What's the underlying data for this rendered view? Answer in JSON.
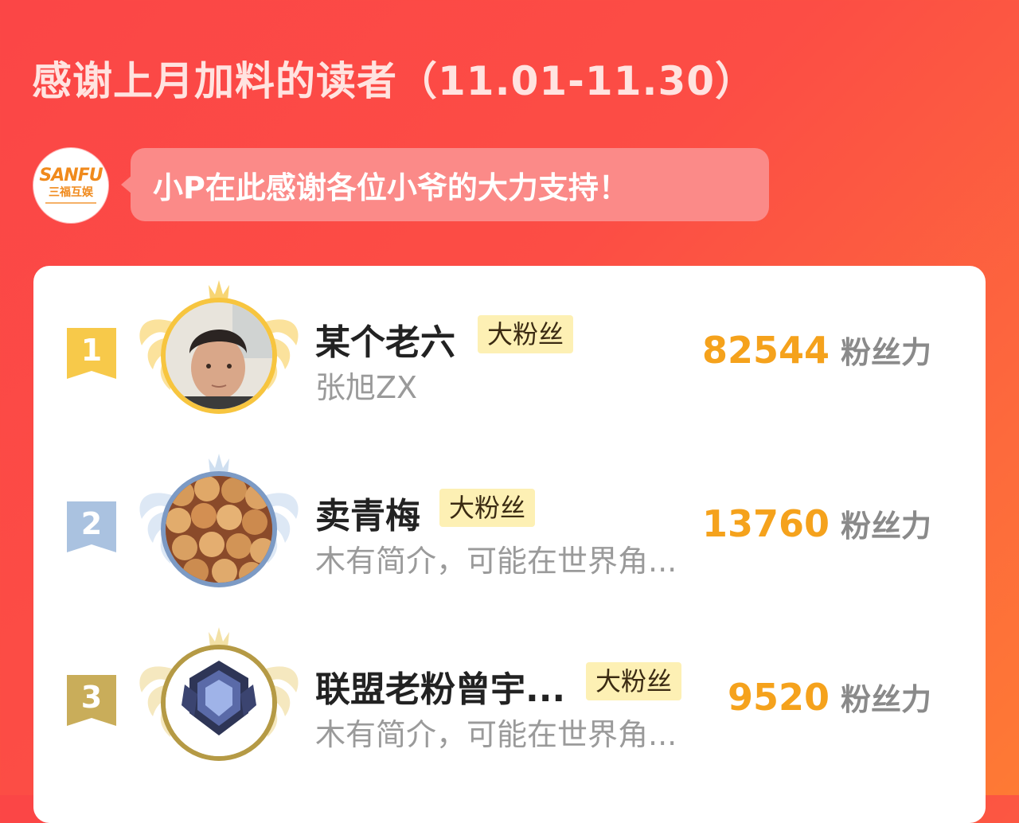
{
  "page_title": "感谢上月加料的读者（11.01-11.30）",
  "logo": {
    "brand": "SANFU",
    "name": "三福互娱"
  },
  "bubble_text": "小P在此感谢各位小爷的大力支持！",
  "ranking": [
    {
      "rank": "1",
      "name": "某个老六",
      "tag": "大粉丝",
      "desc": "张旭ZX",
      "score": "82544",
      "unit": "粉丝力"
    },
    {
      "rank": "2",
      "name": "卖青梅",
      "tag": "大粉丝",
      "desc": "木有简介，可能在世界角...",
      "score": "13760",
      "unit": "粉丝力"
    },
    {
      "rank": "3",
      "name": "联盟老粉曾宇...",
      "tag": "大粉丝",
      "desc": "木有简介，可能在世界角...",
      "score": "9520",
      "unit": "粉丝力"
    }
  ],
  "colors": {
    "gold": "#f7c53f",
    "silver": "#a9bfdc",
    "bronze": "#c9ad5a",
    "score": "#f5a21c"
  }
}
